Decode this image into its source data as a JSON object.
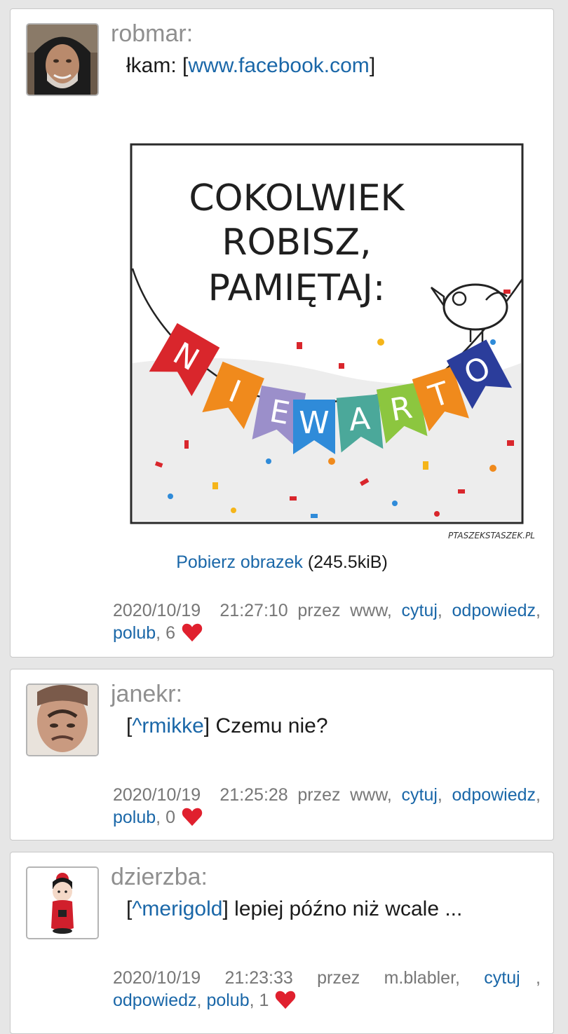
{
  "posts": [
    {
      "username": "robmar:",
      "message_prefix": "łkam: [",
      "link": "www.facebook.com",
      "message_suffix": "]",
      "image": {
        "caption_lines": [
          "COKOLWIEK",
          "ROBISZ,",
          "PAMIĘTAJ:"
        ],
        "banner_letters": [
          "N",
          "I",
          "E",
          "W",
          "A",
          "R",
          "T",
          "O"
        ],
        "watermark": "PTASZEKSTASZEK.PL"
      },
      "download_label": "Pobierz obrazek",
      "download_size": "(245.5kiB)",
      "datetime": "2020/10/19  21:27:10",
      "via": "przez www,",
      "cite_label": "cytuj",
      "reply_label": "odpowiedz",
      "like_label": "polub",
      "likes": ", 6"
    },
    {
      "username": "janekr:",
      "reply_to": "^rmikke",
      "message": "Czemu nie?",
      "datetime": "2020/10/19  21:25:28",
      "via": "przez www,",
      "cite_label": "cytuj",
      "reply_label": "odpowiedz",
      "like_label": "polub",
      "likes": ", 0"
    },
    {
      "username": "dzierzba:",
      "reply_to": "^merigold",
      "message": "lepiej późno niż wcale ...",
      "datetime": "2020/10/19",
      "time": "21:23:33",
      "via": "przez",
      "author": "m.blabler,",
      "cite_label": "cytuj",
      "reply_label": "odpowiedz",
      "like_label": "polub",
      "likes": ", 1"
    }
  ],
  "colors": {
    "link": "#1a67a8",
    "meta": "#777777",
    "username": "#8f8f8f",
    "heart": "#e0202e",
    "background": "#e6e6e6"
  },
  "icons": {
    "heart": "heart-icon"
  }
}
